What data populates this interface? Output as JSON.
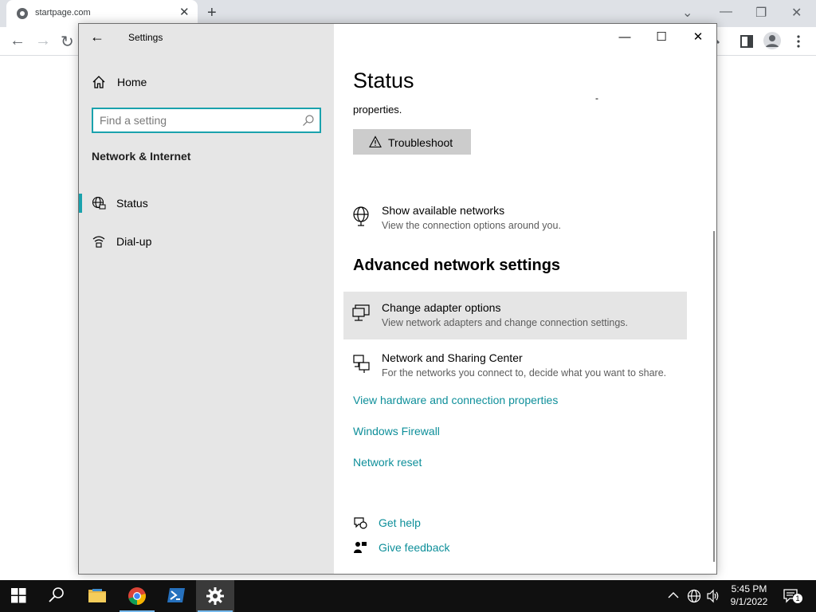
{
  "browser": {
    "tab_title": "startpage.com",
    "tab_close": "✕",
    "new_tab": "+",
    "window_controls": [
      "⌄",
      "—",
      "❐",
      "✕"
    ],
    "nav": {
      "back": "←",
      "forward": "→",
      "reload": "↻"
    }
  },
  "settings": {
    "app_title": "Settings",
    "back_glyph": "←",
    "window_controls": {
      "minimize": "—",
      "maximize": "☐",
      "close": "✕"
    },
    "sidebar": {
      "home_label": "Home",
      "search_placeholder": "Find a setting",
      "section_title": "Network & Internet",
      "items": [
        {
          "label": "Status",
          "icon": "globe-icon",
          "selected": true
        },
        {
          "label": "Dial-up",
          "icon": "dialup-icon",
          "selected": false
        }
      ]
    },
    "main": {
      "title": "Status",
      "properties_text": "properties.",
      "dash": "-",
      "troubleshoot_label": "Troubleshoot",
      "show_networks": {
        "title": "Show available networks",
        "desc": "View the connection options around you."
      },
      "advanced_heading": "Advanced network settings",
      "change_adapter": {
        "title": "Change adapter options",
        "desc": "View network adapters and change connection settings."
      },
      "sharing_center": {
        "title": "Network and Sharing Center",
        "desc": "For the networks you connect to, decide what you want to share."
      },
      "links": [
        "View hardware and connection properties",
        "Windows Firewall",
        "Network reset"
      ],
      "help": {
        "get_help": "Get help",
        "give_feedback": "Give feedback"
      }
    }
  },
  "taskbar": {
    "time": "5:45 PM",
    "date": "9/1/2022",
    "notification_count": "1",
    "accent_color": "#1aa2ad",
    "link_color": "#0e8f9a"
  }
}
